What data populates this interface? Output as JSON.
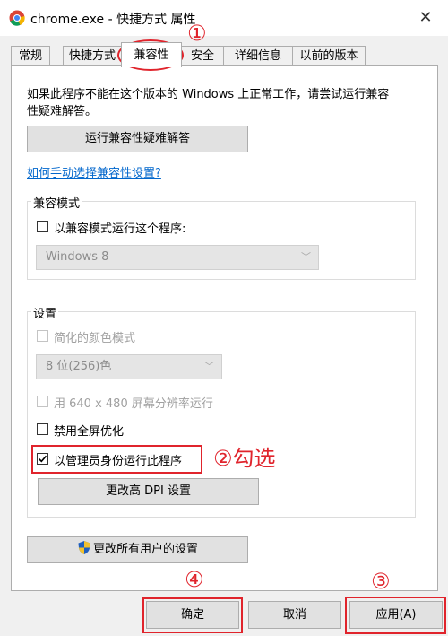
{
  "window": {
    "title": "chrome.exe - 快捷方式 属性",
    "close_glyph": "✕"
  },
  "tabs": [
    {
      "label": "常规"
    },
    {
      "label": "快捷方式"
    },
    {
      "label": "兼容性"
    },
    {
      "label": "安全"
    },
    {
      "label": "详细信息"
    },
    {
      "label": "以前的版本"
    }
  ],
  "panel": {
    "intro_line1": "如果此程序不能在这个版本的 Windows 上正常工作，请尝试运行兼容",
    "intro_line2": "性疑难解答。",
    "troubleshoot_button": "运行兼容性疑难解答",
    "manual_link": "如何手动选择兼容性设置?",
    "compat_mode": {
      "title": "兼容模式",
      "checkbox_label": "以兼容模式运行这个程序:",
      "checked": false,
      "os_select_value": "Windows 8"
    },
    "settings": {
      "title": "设置",
      "reduced_color_label": "简化的颜色模式",
      "color_select_value": "8 位(256)色",
      "resolution_label": "用 640 x 480 屏幕分辨率运行",
      "fullscreen_opt_label": "禁用全屏优化",
      "admin_label": "以管理员身份运行此程序",
      "admin_checked": true,
      "dpi_button": "更改高 DPI 设置"
    },
    "all_users_button": "更改所有用户的设置"
  },
  "footer": {
    "ok": "确定",
    "cancel": "取消",
    "apply": "应用(A)"
  },
  "annotations": {
    "step1": "①",
    "step2": "②勾选",
    "step3": "③",
    "step4": "④"
  },
  "colors": {
    "annotation_red": "#e0242c",
    "link_blue": "#0066cc",
    "shield_blue": "#1f5fbf",
    "shield_yellow": "#f2c12e"
  }
}
